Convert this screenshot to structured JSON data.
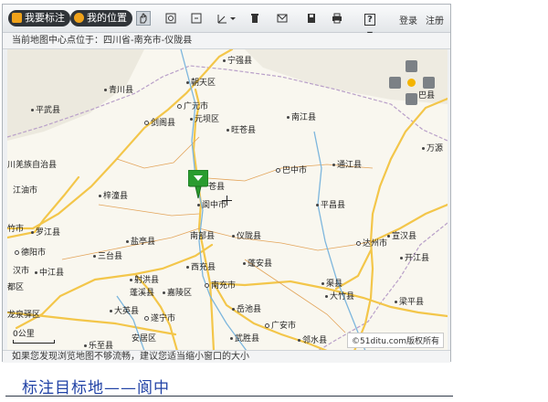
{
  "toolbar": {
    "mark_button": "我要标注",
    "location_button": "我的位置",
    "help_label": "?",
    "login_link": "登录",
    "register_link": "注册"
  },
  "address_bar": {
    "text": "当前地图中心点位于：四川省-南充市-仪陇县"
  },
  "map": {
    "places": [
      {
        "name": "宁强县",
        "mark": "dot"
      },
      {
        "name": "青川县",
        "mark": "dot"
      },
      {
        "name": "朝天区",
        "mark": "dot"
      },
      {
        "name": "广元市",
        "mark": "ring"
      },
      {
        "name": "平武县",
        "mark": "dot"
      },
      {
        "name": "剑阁县",
        "mark": "ring"
      },
      {
        "name": "元坝区",
        "mark": "dot"
      },
      {
        "name": "旺苍县",
        "mark": "dot"
      },
      {
        "name": "南江县",
        "mark": "dot"
      },
      {
        "name": "巴中市",
        "mark": "ring"
      },
      {
        "name": "通江县",
        "mark": "dot"
      },
      {
        "name": "万源",
        "mark": "dot"
      },
      {
        "name": "川羌族自治县",
        "mark": "dot"
      },
      {
        "name": "江油市",
        "mark": "dot"
      },
      {
        "name": "梓潼县",
        "mark": "dot"
      },
      {
        "name": "苍县",
        "mark": "dot"
      },
      {
        "name": "阆中市",
        "mark": "dot"
      },
      {
        "name": "平昌县",
        "mark": "dot"
      },
      {
        "name": "竹市",
        "mark": "dot"
      },
      {
        "name": "罗江县",
        "mark": "dot"
      },
      {
        "name": "盐亭县",
        "mark": "dot"
      },
      {
        "name": "南部县",
        "mark": "dot"
      },
      {
        "name": "仪陇县",
        "mark": "dot"
      },
      {
        "name": "宣汉县",
        "mark": "dot"
      },
      {
        "name": "达州市",
        "mark": "ring"
      },
      {
        "name": "开江县",
        "mark": "dot"
      },
      {
        "name": "德阳市",
        "mark": "ring"
      },
      {
        "name": "三台县",
        "mark": "dot"
      },
      {
        "name": "汉市",
        "mark": "dot"
      },
      {
        "name": "中江县",
        "mark": "dot"
      },
      {
        "name": "蓬安县",
        "mark": "dot"
      },
      {
        "name": "西充县",
        "mark": "dot"
      },
      {
        "name": "射洪县",
        "mark": "dot"
      },
      {
        "name": "蓬溪县",
        "mark": "dot"
      },
      {
        "name": "嘉陵区",
        "mark": "dot"
      },
      {
        "name": "南充市",
        "mark": "ring"
      },
      {
        "name": "渠县",
        "mark": "dot"
      },
      {
        "name": "大竹县",
        "mark": "dot"
      },
      {
        "name": "梁平县",
        "mark": "dot"
      },
      {
        "name": "都区",
        "mark": "dot"
      },
      {
        "name": "龙泉驿区",
        "mark": "dot"
      },
      {
        "name": "大英县",
        "mark": "dot"
      },
      {
        "name": "遂宁市",
        "mark": "ring"
      },
      {
        "name": "岳池县",
        "mark": "dot"
      },
      {
        "name": "广安市",
        "mark": "ring"
      },
      {
        "name": "邻水县",
        "mark": "dot"
      },
      {
        "name": "安居区",
        "mark": "dot"
      },
      {
        "name": "武胜县",
        "mark": "dot"
      },
      {
        "name": "乐至县",
        "mark": "dot"
      },
      {
        "name": "巴县",
        "mark": "dot"
      }
    ],
    "scale_label": "0公里",
    "copyright": "©51ditu.com版权所有",
    "marker_color": "#2a9c2f"
  },
  "notice": {
    "text": "如果您发现浏览地图不够流畅，建议您适当缩小窗口的大小"
  },
  "caption": {
    "text": "标注目标地——阆中"
  }
}
